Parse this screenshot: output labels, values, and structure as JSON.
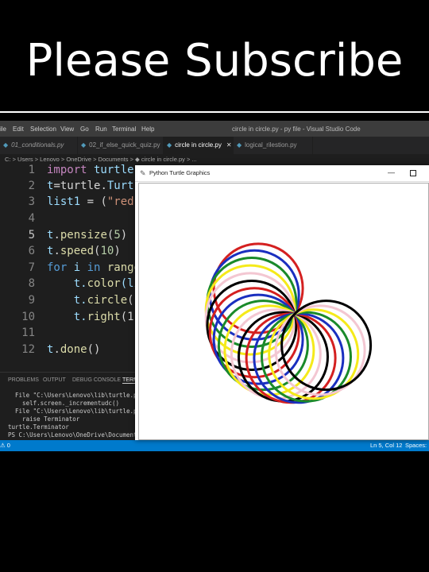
{
  "banner": {
    "title": "Please Subscribe"
  },
  "window": {
    "title": "circle in circle.py - py file - Visual Studio Code"
  },
  "menu": [
    "ile",
    "Edit",
    "Selection",
    "View",
    "Go",
    "Run",
    "Terminal",
    "Help"
  ],
  "tabs": [
    {
      "label": "01_conditionals.py"
    },
    {
      "label": "02_if_else_quick_quiz.py"
    },
    {
      "label": "circle in circle.py"
    },
    {
      "label": "logical_rilestion.py"
    }
  ],
  "breadcrumb": "C: > Users > Lenovo > OneDrive > Documents > ◆ circle in circle.py > ...",
  "code": {
    "line_numbers": [
      "1",
      "2",
      "3",
      "4",
      "5",
      "6",
      "7",
      "8",
      "9",
      "10",
      "11",
      "12"
    ],
    "current_line": "5",
    "l1": {
      "kw": "import",
      "rest": " turtle"
    },
    "l2": {
      "a": "t",
      "b": "=turtle.",
      "c": "Turt"
    },
    "l3": {
      "a": "list1",
      "b": " = (",
      "c": "\"red"
    },
    "l5": {
      "a": "t",
      "b": ".",
      "c": "pensize",
      "d": "(",
      "e": "5",
      "f": ")"
    },
    "l6": {
      "a": "t",
      "b": ".",
      "c": "speed",
      "d": "(",
      "e": "10",
      "f": ")"
    },
    "l7": {
      "kw": "for",
      "a": " i ",
      "kw2": "in",
      "b": " range"
    },
    "l8": {
      "a": "    t.",
      "b": "color",
      "c": "(li"
    },
    "l9": {
      "a": "    t.",
      "b": "circle",
      "c": "("
    },
    "l10": {
      "a": "    t.",
      "b": "right",
      "c": "(1"
    },
    "l12": {
      "a": "t",
      "b": ".",
      "c": "done",
      "d": "()"
    }
  },
  "panel": {
    "tabs": [
      "PROBLEMS",
      "OUTPUT",
      "DEBUG CONSOLE",
      "TERM"
    ],
    "terminal": [
      "  File \"C:\\Users\\Lenovo\\lib\\turtle.py\",",
      "    self.screen._incrementudc()",
      "  File \"C:\\Users\\Lenovo\\lib\\turtle.py\",",
      "    raise Terminator",
      "turtle.Terminator",
      "PS C:\\Users\\Lenovo\\OneDrive\\Documents\\py"
    ]
  },
  "status": {
    "left": "⚠ 0",
    "position": "Ln 5, Col 12",
    "spaces": "Spaces: 4"
  },
  "turtle_window": {
    "title": "Python Turtle Graphics",
    "minimize": "—"
  },
  "colors": {
    "accent": "#007acc",
    "circles": [
      "#d42020",
      "#1a2fbf",
      "#1a8a2a",
      "#f5ea1a",
      "#f3c7d2",
      "#000000"
    ]
  }
}
